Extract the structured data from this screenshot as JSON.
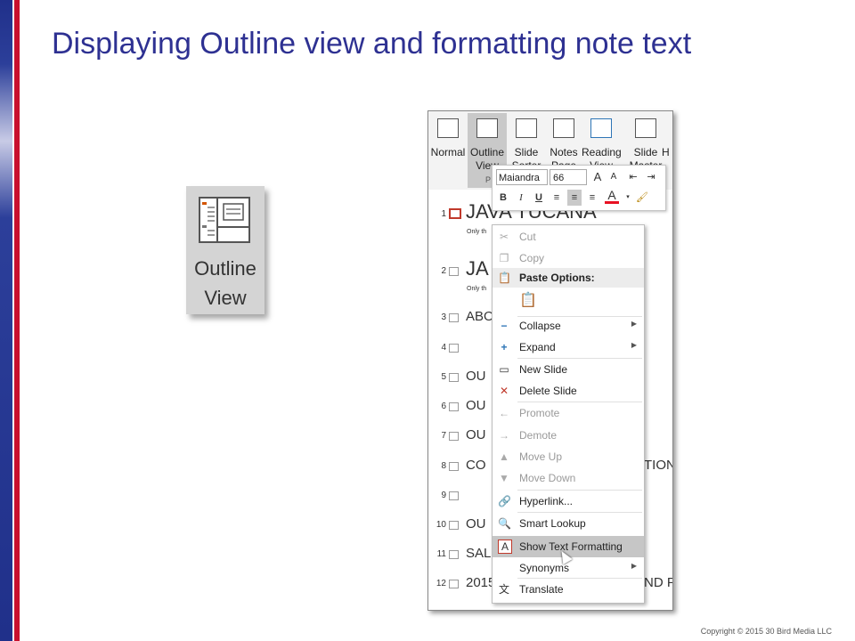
{
  "slide": {
    "title": "Displaying Outline view and formatting note text",
    "copyright": "Copyright © 2015 30 Bird Media LLC"
  },
  "outline_button": {
    "line1": "Outline",
    "line2": "View"
  },
  "ribbon": {
    "buttons": [
      {
        "label": "Normal"
      },
      {
        "label": "Outline View"
      },
      {
        "label": "Slide Sorter"
      },
      {
        "label": "Notes Page"
      },
      {
        "label": "Reading View"
      },
      {
        "label": "Slide Master"
      }
    ],
    "group_fragment": "P",
    "trailing_fragment": "H"
  },
  "mini_toolbar": {
    "font": "Maiandra",
    "size": "66",
    "grow": "A",
    "shrink": "A",
    "bold": "B",
    "italic": "I",
    "underline": "U",
    "font_color": "A"
  },
  "outline_rows": [
    {
      "num": "1",
      "text": "JAVA TUCANA",
      "sub": "Only th"
    },
    {
      "num": "2",
      "text": "JA",
      "sub": "Only th"
    },
    {
      "num": "3",
      "text": "ABO"
    },
    {
      "num": "4",
      "text": ""
    },
    {
      "num": "5",
      "text": "OU"
    },
    {
      "num": "6",
      "text": "OU"
    },
    {
      "num": "7",
      "text": "OU"
    },
    {
      "num": "8",
      "text": "CO",
      "tail": "TION"
    },
    {
      "num": "9",
      "text": ""
    },
    {
      "num": "10",
      "text": "OU"
    },
    {
      "num": "11",
      "text": "SAL"
    },
    {
      "num": "12",
      "text": "2015",
      "tail": "ND F"
    }
  ],
  "context_menu": {
    "items": [
      {
        "label": "Cut",
        "icon": "cut-icon",
        "disabled": true
      },
      {
        "label": "Copy",
        "icon": "copy-icon",
        "disabled": true
      },
      {
        "label": "Paste Options:",
        "icon": "paste-icon",
        "header": true
      },
      {
        "label": "",
        "icon": "paste-keep-text-icon"
      },
      {
        "label": "Collapse",
        "icon": "collapse-icon",
        "submenu": true
      },
      {
        "label": "Expand",
        "icon": "expand-icon",
        "submenu": true
      },
      {
        "label": "New Slide",
        "icon": "new-slide-icon"
      },
      {
        "label": "Delete Slide",
        "icon": "delete-slide-icon"
      },
      {
        "label": "Promote",
        "icon": "promote-icon",
        "disabled": true
      },
      {
        "label": "Demote",
        "icon": "demote-icon",
        "disabled": true
      },
      {
        "label": "Move Up",
        "icon": "move-up-icon",
        "disabled": true
      },
      {
        "label": "Move Down",
        "icon": "move-down-icon",
        "disabled": true
      },
      {
        "label": "Hyperlink...",
        "icon": "hyperlink-icon"
      },
      {
        "label": "Smart Lookup",
        "icon": "smart-lookup-icon"
      },
      {
        "label": "Show Text Formatting",
        "icon": "text-formatting-icon",
        "highlighted": true
      },
      {
        "label": "Synonyms",
        "icon": "",
        "submenu": true
      },
      {
        "label": "Translate",
        "icon": "translate-icon"
      }
    ]
  },
  "colors": {
    "title": "#2e3192",
    "accent_blue": "#20308a",
    "accent_red": "#c8102e",
    "font_color_swatch": "#e81123"
  }
}
